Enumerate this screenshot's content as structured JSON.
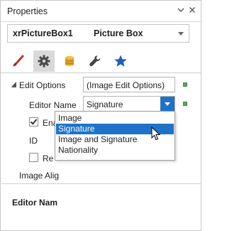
{
  "window": {
    "title": "Properties",
    "pin_glyph": "⌄",
    "close_glyph": "✕"
  },
  "selector": {
    "component_name": "xrPictureBox1",
    "component_type": "Picture Box"
  },
  "tabs": [
    {
      "icon": "brush-icon",
      "active": false
    },
    {
      "icon": "gear-icon",
      "active": true
    },
    {
      "icon": "database-icon",
      "active": false
    },
    {
      "icon": "wrench-icon",
      "active": false
    },
    {
      "icon": "star-icon",
      "active": false
    }
  ],
  "properties": {
    "edit_options": {
      "label": "Edit Options",
      "value": "(Image Edit Options)"
    },
    "editor_name": {
      "label": "Editor Name",
      "value": "Signature"
    },
    "enabled": {
      "label": "Ena",
      "checked": true
    },
    "id": {
      "label": "ID"
    },
    "read_only": {
      "label": "Re",
      "checked": false
    },
    "image_alignment": {
      "label": "Image Alig"
    }
  },
  "description": {
    "title": "Editor Nam"
  },
  "dropdown": {
    "options": [
      "Image",
      "Signature",
      "Image and Signature",
      "Nationality"
    ],
    "selected": "Signature"
  },
  "colors": {
    "accent": "#1e73c8",
    "modified_indicator": "#5aa858",
    "tab_active_bg": "#d9d9d9",
    "brush": "#c0392b",
    "database": "#e0a526",
    "star": "#1f5fb8"
  }
}
